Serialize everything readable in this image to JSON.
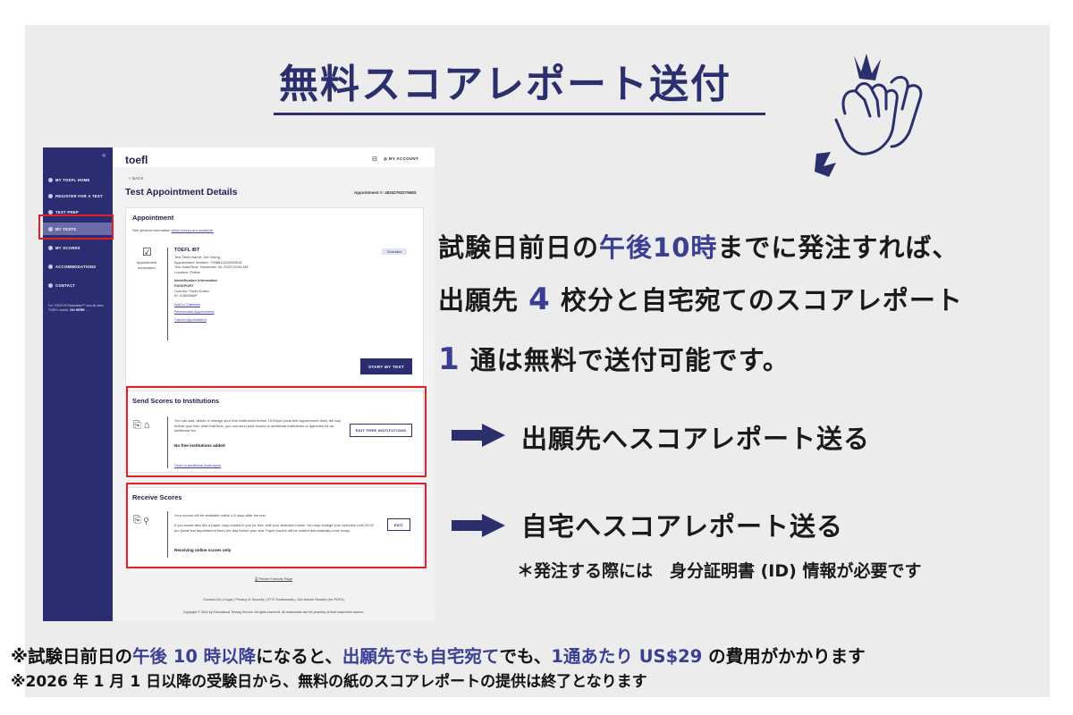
{
  "header": {
    "title": "無料スコアレポート送付"
  },
  "screenshot": {
    "sidebar": {
      "collapse": "«",
      "items": [
        {
          "label": "MY TOEFL HOME"
        },
        {
          "label": "REGISTER FOR A TEST"
        },
        {
          "label": "TEST PREP"
        },
        {
          "label": "MY TESTS"
        },
        {
          "label": "MY SCORES"
        },
        {
          "label": "ACCOMMODATIONS"
        },
        {
          "label": "CONTACT"
        }
      ],
      "note_text": "For TOEFL® Essentials™ and all other TOEFL needs,",
      "note_link": "GO HERE →"
    },
    "topbar": {
      "logo": "toefl",
      "account": "MY ACCOUNT"
    },
    "back": "< BACK",
    "page_title": "Test Appointment Details",
    "appointment_number": "Appointment #: 4834276327568S",
    "appointment": {
      "heading": "Appointment",
      "intro": "See general information",
      "intro_link": "when scores are available.",
      "icon_label": "Appointment Information",
      "status": "Scheduled",
      "test_name": "TOEFL iBT",
      "taker": "Test Taker Name: Joe Young",
      "number": "Appointment Number: 7998811220493816",
      "datetime": "Test Date/Time: November 30, 2023 09:00 AM",
      "location": "Location: Online",
      "id_heading": "Identification Information",
      "id_type": "PASSPORT",
      "country": "Country: South Korea",
      "id_number": "ID: K28926MF",
      "links": [
        "Add to Calendar",
        "Reschedule Appointment",
        "Cancel Appointment"
      ],
      "start_button": "START MY TEST"
    },
    "send_scores": {
      "heading": "Send Scores to Institutions",
      "body": "You can add, delete or change your free institutions before 10:00pm (local test appointment time) the day before your test. After that time, you can send your scores to additional institutions or agencies for an additional fee.",
      "empty": "No free institutions added",
      "link": "Send to additional institutions",
      "button": "EDIT FREE INSTITUTIONS"
    },
    "receive_scores": {
      "heading": "Receive Scores",
      "body1": "Your scores will be available online 4-8 days after the test.",
      "body2": "If you would also like a paper copy mailed to you for free, edit your selection below. You may change your selection until 10:00 pm (local test appointment time) the day before your test. Paper copies will be mailed automatically once ready.",
      "status": "Receiving online scores only",
      "button": "EDIT"
    },
    "printer_link": "Printer Friendly Page",
    "footer_links": "Contact Us | Legal | Privacy & Security | ETS Trademarks | Get Adobe Reader (for PDFs)",
    "copyright": "Copyright © 2024 by Educational Testing Service. All rights reserved. All trademarks are the property of their respective owners."
  },
  "right": {
    "line1_a": "試験日前日の",
    "line1_b": "午後10時",
    "line1_c": "までに発注すれば、",
    "line2_a": "出願先 ",
    "line2_b": "4",
    "line2_c": " 校分と自宅宛てのスコアレポート",
    "line3_a": "1",
    "line3_b": " 通は無料で送付可能です。",
    "arrow1": "出願先へスコアレポート送る",
    "arrow2": "自宅へスコアレポート送る",
    "note": "＊発注する際には　身分証明書 (ID) 情報が必要です"
  },
  "bottom": {
    "l1_a": "※試験日前日の",
    "l1_b": "午後 10 時以降",
    "l1_c": "になると、",
    "l1_d": "出願先でも自宅宛て",
    "l1_e": "でも、",
    "l1_f": "1通あたり US$29",
    "l1_g": " の費用がかかります",
    "l2": "※2026 年 1 月 1 日以降の受験日から、無料の紙のスコアレポートの提供は終了となります"
  },
  "colors": {
    "accent": "#3b3f93",
    "sidebar": "#2b2d72",
    "highlight_box": "#e0212a"
  }
}
